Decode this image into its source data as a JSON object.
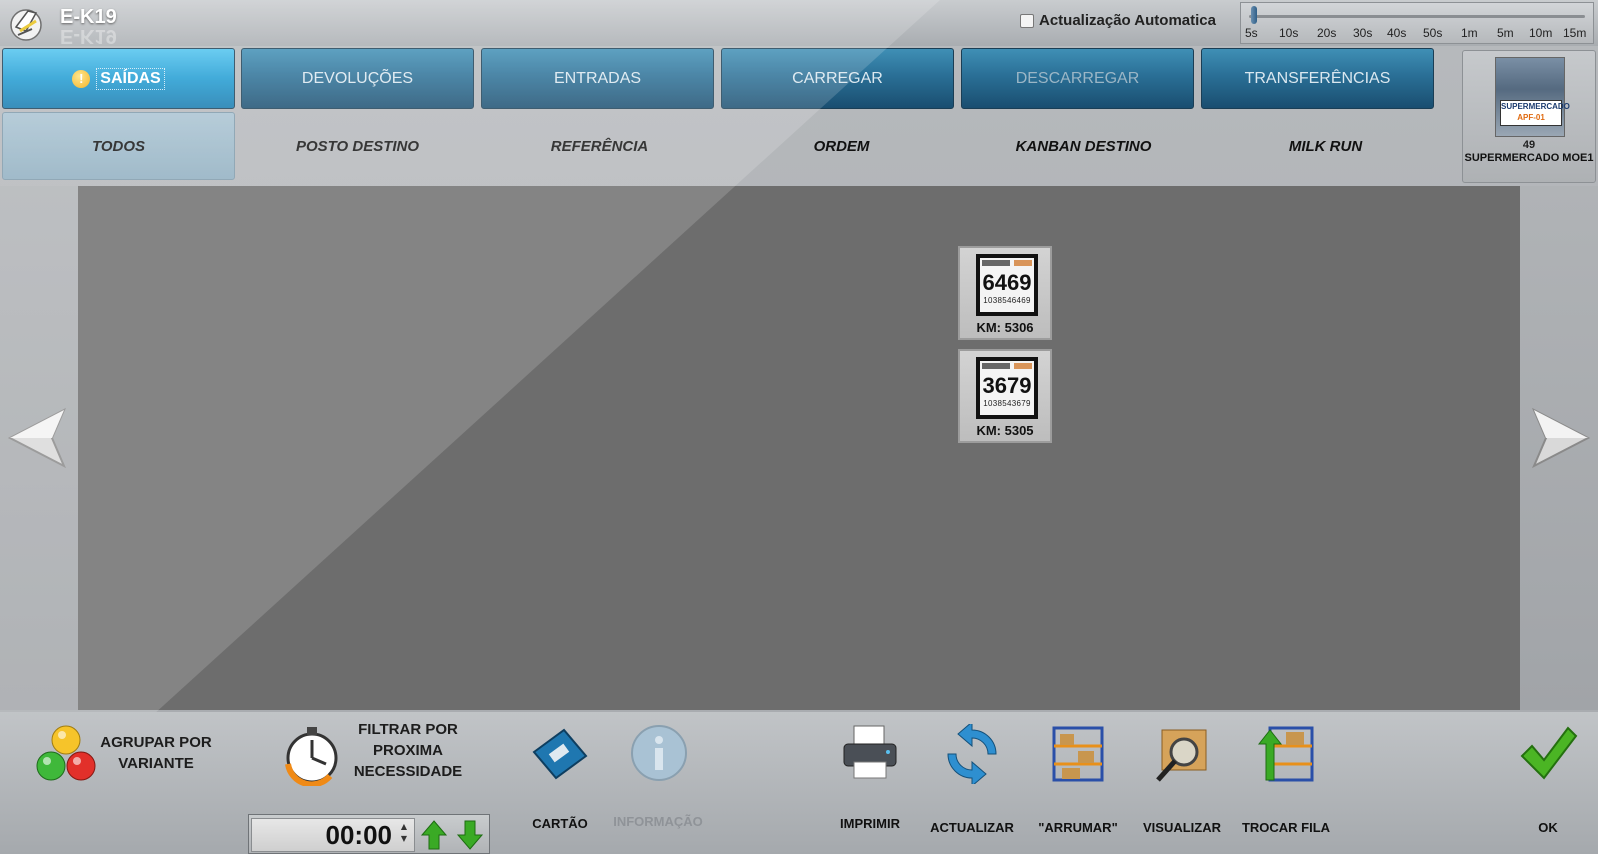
{
  "app": {
    "title": "E-K19"
  },
  "auto_update": {
    "label": "Actualização Automatica",
    "checked": false
  },
  "interval_slider": {
    "ticks": [
      "5s",
      "10s",
      "20s",
      "30s",
      "40s",
      "50s",
      "1m",
      "5m",
      "10m",
      "15m"
    ],
    "selected": "5s"
  },
  "tabs": [
    {
      "label": "SAÍDAS",
      "state": "active",
      "warning": "!"
    },
    {
      "label": "DEVOLUÇÕES",
      "state": "normal"
    },
    {
      "label": "ENTRADAS",
      "state": "normal"
    },
    {
      "label": "CARREGAR",
      "state": "normal"
    },
    {
      "label": "DESCARREGAR",
      "state": "disabled"
    },
    {
      "label": "TRANSFERÊNCIAS",
      "state": "normal"
    }
  ],
  "filters": [
    {
      "label": "TODOS",
      "active": true
    },
    {
      "label": "POSTO DESTINO"
    },
    {
      "label": "REFERÊNCIA"
    },
    {
      "label": "ORDEM"
    },
    {
      "label": "KANBAN DESTINO"
    },
    {
      "label": "MILK RUN"
    }
  ],
  "market": {
    "sign_title": "SUPERMERCADO",
    "sign_code": "APF-01",
    "count": "49",
    "name": "SUPERMERCADO MOE1"
  },
  "kanbans": [
    {
      "number": "6469",
      "barcode": "1038546469",
      "km": "KM: 5306"
    },
    {
      "number": "3679",
      "barcode": "1038543679",
      "km": "KM: 5305"
    }
  ],
  "toolbar": {
    "group_by_variant": "AGRUPAR POR VARIANTE",
    "filter_by_need_1": "FILTRAR POR",
    "filter_by_need_2": "PROXIMA",
    "filter_by_need_3": "NECESSIDADE",
    "time_value": "00:00",
    "card": "CARTÃO",
    "info": "INFORMAÇÃO",
    "print": "IMPRIMIR",
    "refresh": "ACTUALIZAR",
    "arrange": "\"ARRUMAR\"",
    "view": "VISUALIZAR",
    "switch_queue": "TROCAR FILA",
    "ok": "OK"
  },
  "colors": {
    "tab_active": "#1e9bd2",
    "tab_normal": "#2a6f96",
    "main_area": "#6d6d6d",
    "ok_green": "#4bb524"
  }
}
